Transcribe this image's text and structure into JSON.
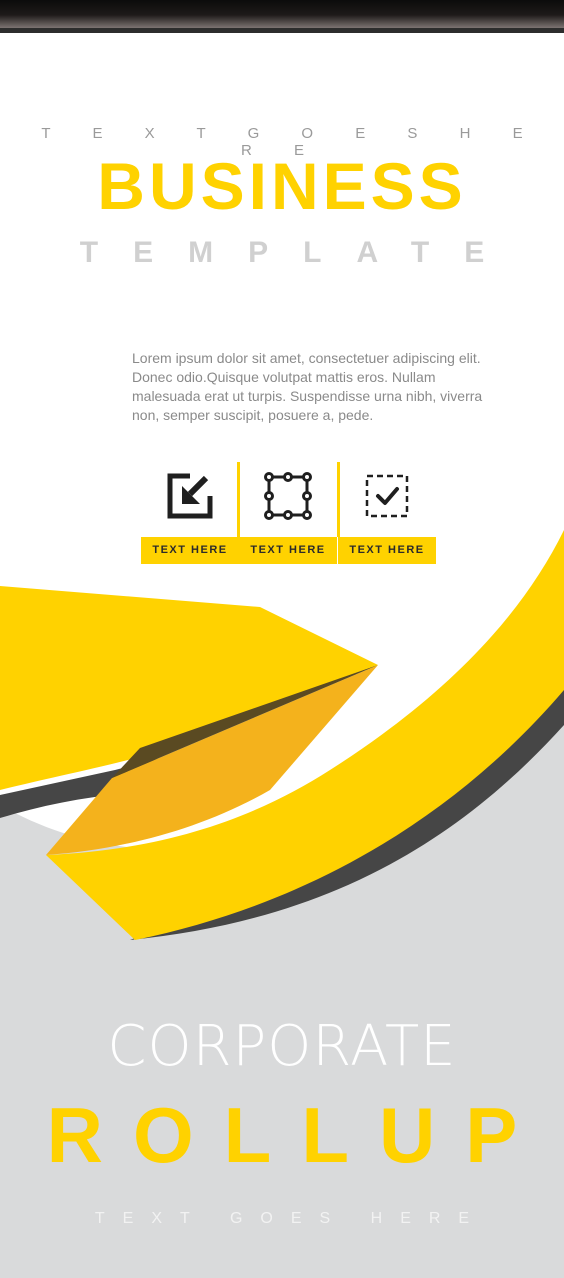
{
  "header": {
    "kicker": "T E X T   G O E S   H E R E",
    "title": "BUSINESS",
    "subtitle": "TEMPLATE"
  },
  "body_text": "Lorem ipsum dolor sit amet, consectetuer adipiscing elit. Donec odio.Quisque volutpat mattis eros. Nullam malesuada erat ut turpis. Suspendisse urna nibh, viverra non, semper suscipit, posuere a, pede.",
  "features": [
    {
      "icon": "import-arrow-icon",
      "label": "TEXT HERE"
    },
    {
      "icon": "selection-box-icon",
      "label": "TEXT HERE"
    },
    {
      "icon": "dashed-checkbox-icon",
      "label": "TEXT HERE"
    }
  ],
  "footer": {
    "headline": "CORPORATE",
    "title": "ROLLUP",
    "kicker": "TEXT GOES HERE"
  },
  "colors": {
    "accent": "#ffd200",
    "accent_dark": "#f4b21c",
    "shadow": "#464646",
    "grey_panel": "#d9dadb",
    "text_grey": "#8a8a8a"
  }
}
